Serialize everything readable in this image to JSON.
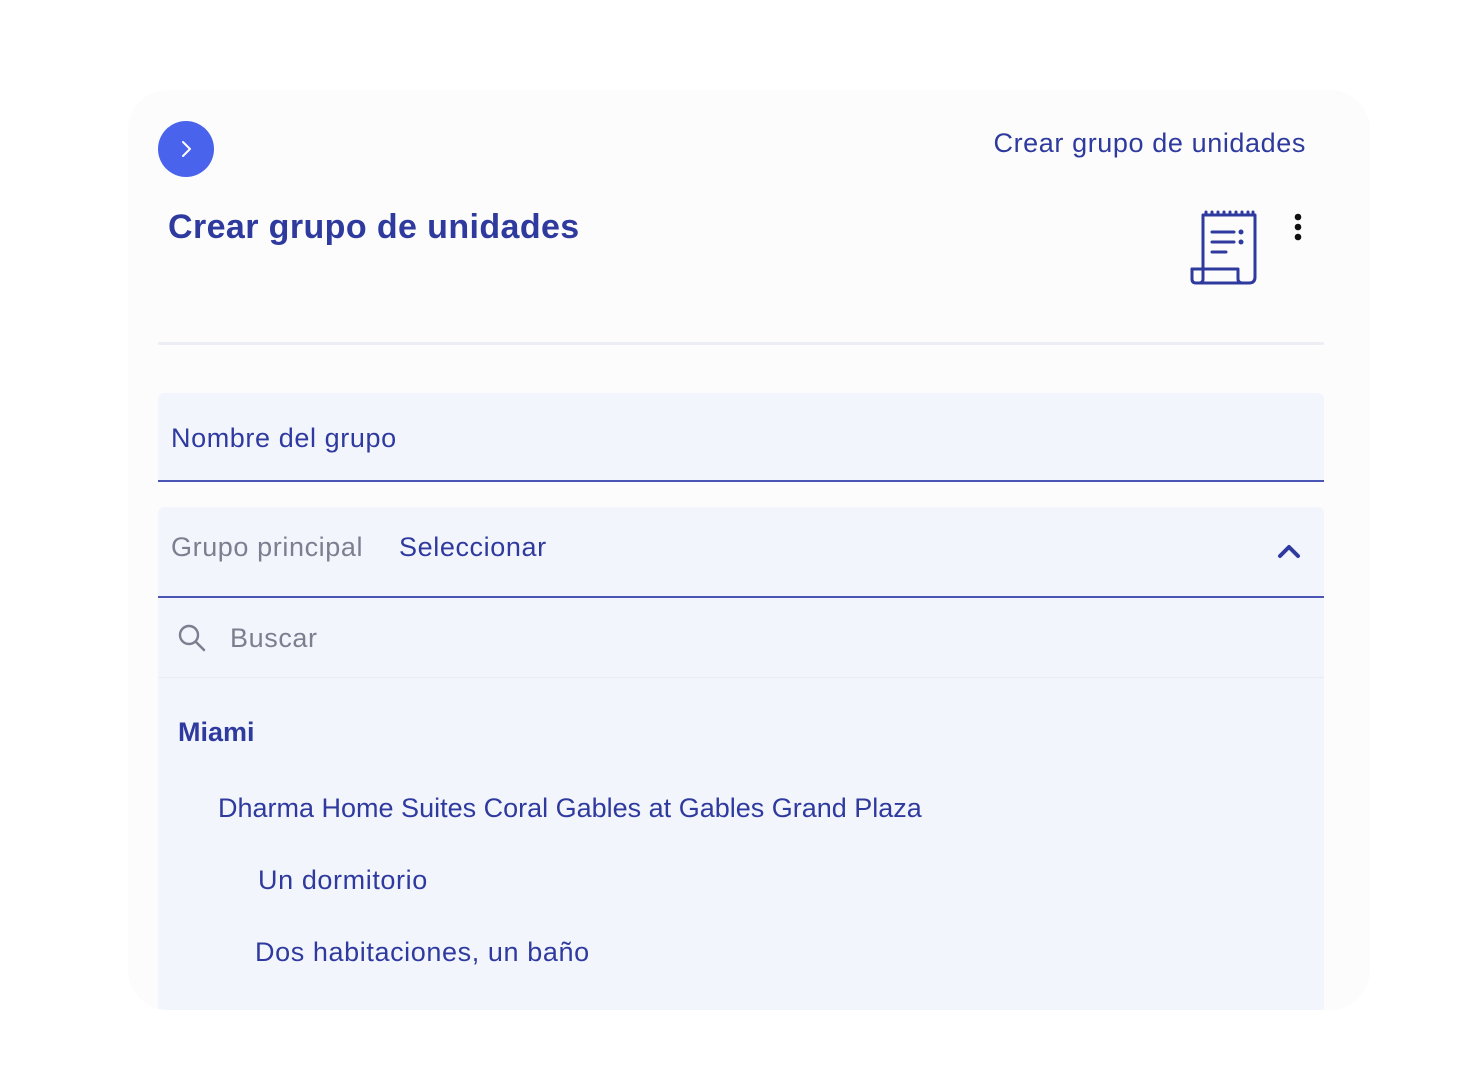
{
  "header": {
    "back_icon": "chevron-right-icon",
    "link_label": "Crear grupo de unidades",
    "title": "Crear grupo de unidades",
    "doc_icon": "receipt-icon",
    "more_icon": "more-vertical-icon"
  },
  "form": {
    "name_field": {
      "label": "Nombre del grupo",
      "value": ""
    },
    "parent_select": {
      "label": "Grupo principal",
      "value": "Seleccionar",
      "expanded": true,
      "chevron_icon": "chevron-up-icon"
    },
    "search": {
      "placeholder": "Buscar",
      "icon": "search-icon"
    },
    "tree": {
      "group": "Miami",
      "property": "Dharma Home Suites Coral Gables at Gables Grand Plaza",
      "units": [
        "Un dormitorio",
        "Dos habitaciones, un baño"
      ]
    }
  },
  "colors": {
    "accent": "#4a63ec",
    "text_primary": "#2f3a9e",
    "text_muted": "#7b7f8f",
    "field_bg": "#f3f5fd",
    "card_bg": "#fcfcfd"
  }
}
